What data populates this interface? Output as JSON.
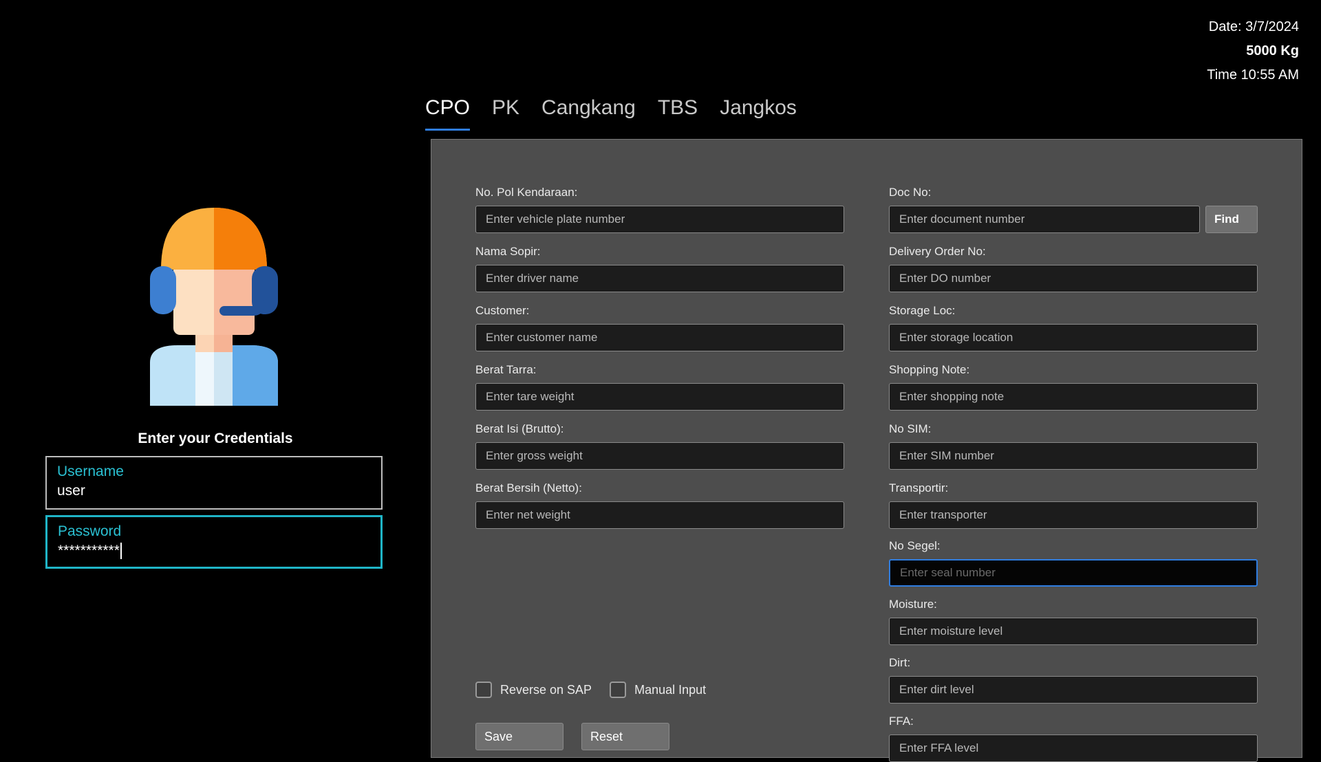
{
  "status": {
    "date": "Date: 3/7/2024",
    "weight": "5000 Kg",
    "time": "Time 10:55 AM"
  },
  "login": {
    "title": "Enter your Credentials",
    "username_label": "Username",
    "username_value": "user",
    "password_label": "Password",
    "password_value": "***********"
  },
  "tabs": [
    {
      "label": "CPO",
      "active": true
    },
    {
      "label": "PK"
    },
    {
      "label": "Cangkang"
    },
    {
      "label": "TBS"
    },
    {
      "label": "Jangkos"
    }
  ],
  "form": {
    "left": [
      {
        "label": "No. Pol Kendaraan:",
        "placeholder": "Enter vehicle plate number"
      },
      {
        "label": "Nama Sopir:",
        "placeholder": "Enter driver name"
      },
      {
        "label": "Customer:",
        "placeholder": "Enter customer name"
      },
      {
        "label": "Berat Tarra:",
        "placeholder": "Enter tare weight"
      },
      {
        "label": "Berat Isi (Brutto):",
        "placeholder": "Enter gross weight"
      },
      {
        "label": "Berat Bersih (Netto):",
        "placeholder": "Enter net weight"
      }
    ],
    "right": [
      {
        "label": "Doc No:",
        "placeholder": "Enter document number"
      },
      {
        "label": "Delivery Order No:",
        "placeholder": "Enter DO number"
      },
      {
        "label": "Storage Loc:",
        "placeholder": "Enter storage location"
      },
      {
        "label": "Shopping Note:",
        "placeholder": "Enter shopping note"
      },
      {
        "label": "No SIM:",
        "placeholder": "Enter SIM number"
      },
      {
        "label": "Transportir:",
        "placeholder": "Enter transporter"
      },
      {
        "label": "No Segel:",
        "placeholder": "Enter seal number"
      },
      {
        "label": "Moisture:",
        "placeholder": "Enter moisture level"
      },
      {
        "label": "Dirt:",
        "placeholder": "Enter dirt level"
      },
      {
        "label": "FFA:",
        "placeholder": "Enter FFA level"
      }
    ],
    "find_label": "Find",
    "checkboxes": {
      "reverse_sap": "Reverse on SAP",
      "manual_input": "Manual Input"
    },
    "save_label": "Save",
    "reset_label": "Reset"
  },
  "colors": {
    "accent": "#2f7de0",
    "field_focus": "#1fb5c7",
    "panel_bg": "#4d4d4d",
    "avatar_helmet": "#f7a128",
    "avatar_headset": "#2e6fbf"
  },
  "icons": {
    "avatar": "support-agent-avatar-icon"
  }
}
